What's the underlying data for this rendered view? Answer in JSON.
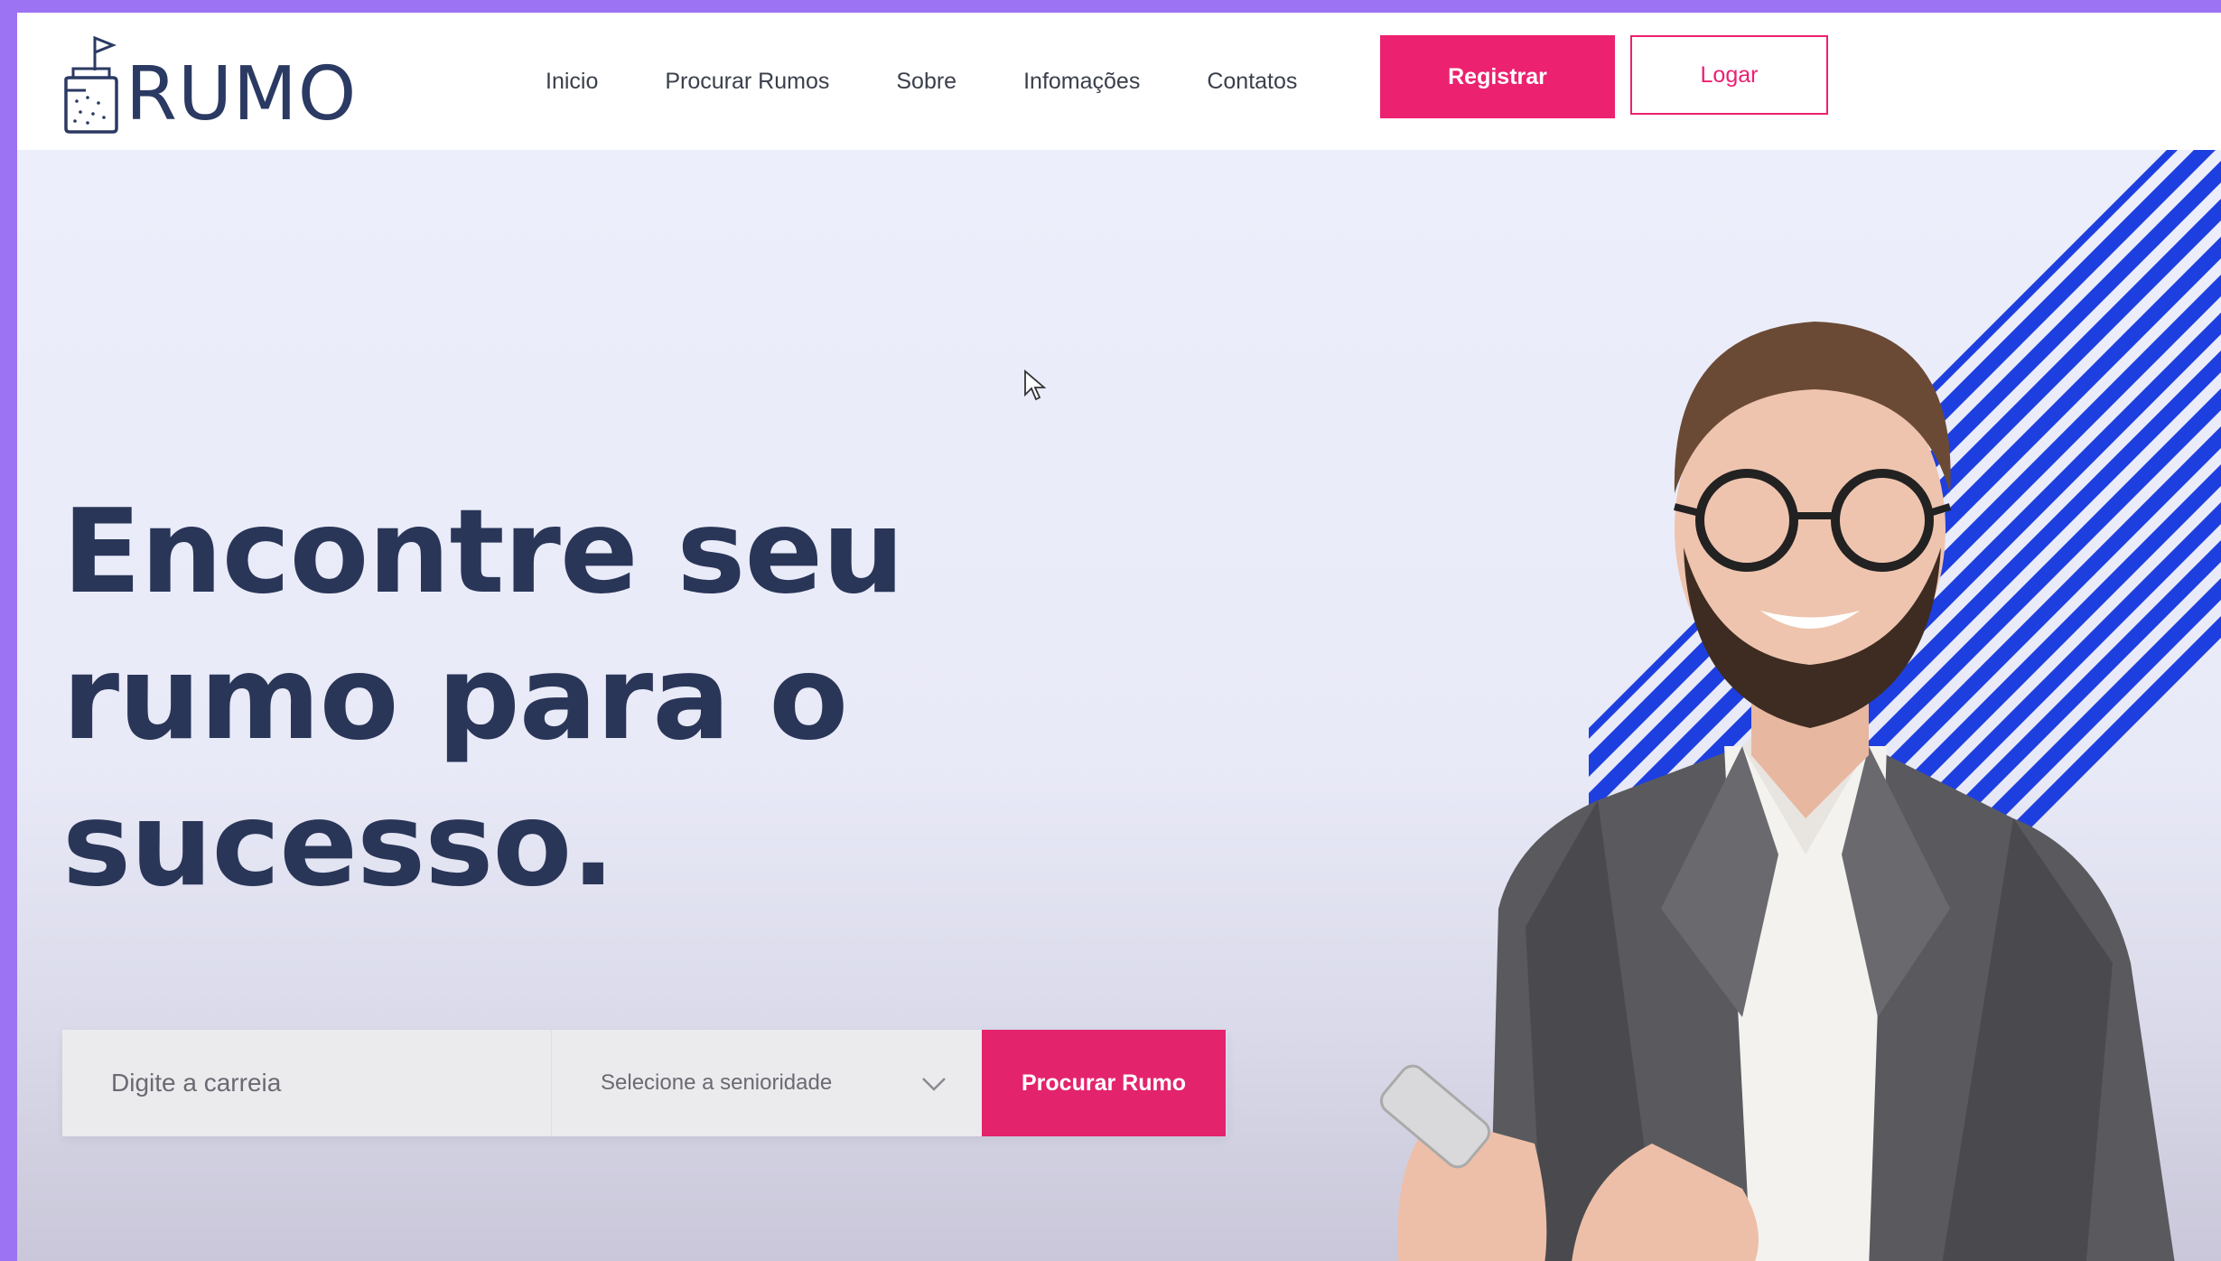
{
  "brand": {
    "name": "RUMO",
    "icon": "jar-flag-icon"
  },
  "nav": {
    "items": [
      {
        "label": "Inicio"
      },
      {
        "label": "Procurar Rumos"
      },
      {
        "label": "Sobre"
      },
      {
        "label": "Infomações"
      },
      {
        "label": "Contatos"
      }
    ],
    "register_label": "Registrar",
    "login_label": "Logar"
  },
  "hero": {
    "headline_lines": [
      "Encontre seu",
      "rumo para o",
      "sucesso."
    ]
  },
  "search": {
    "career_placeholder": "Digite a carreia",
    "seniority_selected": "Selecione a senioridade",
    "submit_label": "Procurar Rumo"
  },
  "colors": {
    "accent": "#ec2170",
    "brand_navy": "#2a3658",
    "stripes": "#1e3fe0",
    "hero_bg": "#e9eaf7"
  },
  "image": {
    "photo": "smiling-man-with-glasses-and-phone"
  }
}
